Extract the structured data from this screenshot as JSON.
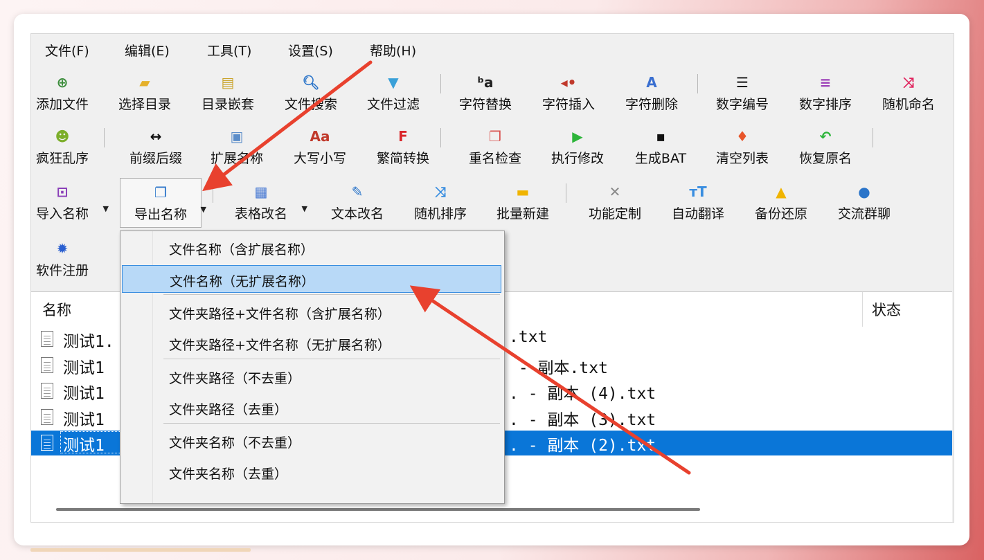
{
  "menu": [
    "文件(F)",
    "编辑(E)",
    "工具(T)",
    "设置(S)",
    "帮助(H)"
  ],
  "toolbar": {
    "row1": [
      {
        "label": "添加文件",
        "icon": "add-file-icon",
        "glyph": "⊕",
        "color": "#3c8d3c"
      },
      {
        "label": "选择目录",
        "icon": "open-folder-icon",
        "glyph": "▰",
        "color": "#e5b02a"
      },
      {
        "label": "目录嵌套",
        "icon": "nested-folder-icon",
        "glyph": "▤",
        "color": "#c9a227"
      },
      {
        "label": "文件搜索",
        "icon": "search-icon",
        "glyph": "🔍︎",
        "color": "#2a74c9"
      },
      {
        "label": "文件过滤",
        "icon": "filter-icon",
        "glyph": "▼",
        "color": "#3aa0d8"
      },
      {
        "label": "字符替换",
        "icon": "replace-char-icon",
        "glyph": "ᵇa",
        "color": "#222222"
      },
      {
        "label": "字符插入",
        "icon": "insert-char-icon",
        "glyph": "◂•",
        "color": "#c0392b"
      },
      {
        "label": "字符删除",
        "icon": "delete-char-icon",
        "glyph": "A",
        "color": "#3a6fd0"
      },
      {
        "label": "数字编号",
        "icon": "numbered-list-icon",
        "glyph": "☰",
        "color": "#111111"
      },
      {
        "label": "数字排序",
        "icon": "sort-lines-icon",
        "glyph": "≡",
        "color": "#9b3fb8"
      },
      {
        "label": "随机命名",
        "icon": "shuffle-icon",
        "glyph": "⤨",
        "color": "#e0245e"
      }
    ],
    "row2": [
      {
        "label": "疯狂乱序",
        "icon": "crazy-face-icon",
        "glyph": "☻",
        "color": "#7cae2a"
      },
      {
        "label": "前缀后缀",
        "icon": "double-arrow-icon",
        "glyph": "↔",
        "color": "#111111"
      },
      {
        "label": "扩展名称",
        "icon": "disk-icon",
        "glyph": "▣",
        "color": "#5b8dc9"
      },
      {
        "label": "大写小写",
        "icon": "case-icon",
        "glyph": "Aa",
        "color": "#c0392b"
      },
      {
        "label": "繁简转换",
        "icon": "convert-f-icon",
        "glyph": "F",
        "color": "#d9262a"
      },
      {
        "label": "重名检查",
        "icon": "duplicate-icon",
        "glyph": "❐",
        "color": "#d9534f"
      },
      {
        "label": "执行修改",
        "icon": "play-icon",
        "glyph": "▶",
        "color": "#2db53a"
      },
      {
        "label": "生成BAT",
        "icon": "terminal-icon",
        "glyph": "▪",
        "color": "#111111"
      },
      {
        "label": "清空列表",
        "icon": "broom-icon",
        "glyph": "♦",
        "color": "#e8552a"
      },
      {
        "label": "恢复原名",
        "icon": "undo-icon",
        "glyph": "↶",
        "color": "#2db53a"
      }
    ],
    "row3": [
      {
        "label": "导入名称",
        "icon": "import-icon",
        "glyph": "⊡",
        "color": "#8a3fb8",
        "dropdown": true
      },
      {
        "label": "导出名称",
        "icon": "export-icon",
        "glyph": "❐",
        "color": "#2a74c9",
        "dropdown": true
      },
      {
        "label": "表格改名",
        "icon": "table-icon",
        "glyph": "▦",
        "color": "#3a6fd0",
        "dropdown": true
      },
      {
        "label": "文本改名",
        "icon": "edit-text-icon",
        "glyph": "✎",
        "color": "#2a74c9"
      },
      {
        "label": "随机排序",
        "icon": "random-sort-icon",
        "glyph": "⤨",
        "color": "#3a8ee0"
      },
      {
        "label": "批量新建",
        "icon": "new-folder-icon",
        "glyph": "▬",
        "color": "#f0b400"
      },
      {
        "label": "功能定制",
        "icon": "tools-icon",
        "glyph": "✕",
        "color": "#888888"
      },
      {
        "label": "自动翻译",
        "icon": "translate-icon",
        "glyph": "ᴛT",
        "color": "#3a8ee0"
      },
      {
        "label": "备份还原",
        "icon": "drive-icon",
        "glyph": "▲",
        "color": "#f0b400"
      },
      {
        "label": "交流群聊",
        "icon": "qq-icon",
        "glyph": "●",
        "color": "#2a74c9"
      }
    ],
    "row4": [
      {
        "label": "软件注册",
        "icon": "gear-icon",
        "glyph": "✹",
        "color": "#2a5fd0"
      }
    ]
  },
  "list": {
    "columns": {
      "name": "名称",
      "status": "状态"
    },
    "rows": [
      {
        "name": "测试1.",
        "rest": ".txt",
        "selected": false
      },
      {
        "name": "测试1",
        "rest": " - 副本.txt",
        "selected": false
      },
      {
        "name": "测试1",
        "rest": ". - 副本 (4).txt",
        "selected": false
      },
      {
        "name": "测试1",
        "rest": ". - 副本 (3).txt",
        "selected": false
      },
      {
        "name": "测试1",
        "rest": ". - 副本 (2).txt",
        "selected": true
      }
    ]
  },
  "export_menu": {
    "groups": [
      [
        "文件名称（含扩展名称）",
        "文件名称（无扩展名称）"
      ],
      [
        "文件夹路径+文件名称（含扩展名称）",
        "文件夹路径+文件名称（无扩展名称）"
      ],
      [
        "文件夹路径（不去重）",
        "文件夹路径（去重）"
      ],
      [
        "文件夹名称（不去重）",
        "文件夹名称（去重）"
      ]
    ],
    "highlighted": "文件名称（无扩展名称）"
  },
  "annotation_color": "#e8412e"
}
